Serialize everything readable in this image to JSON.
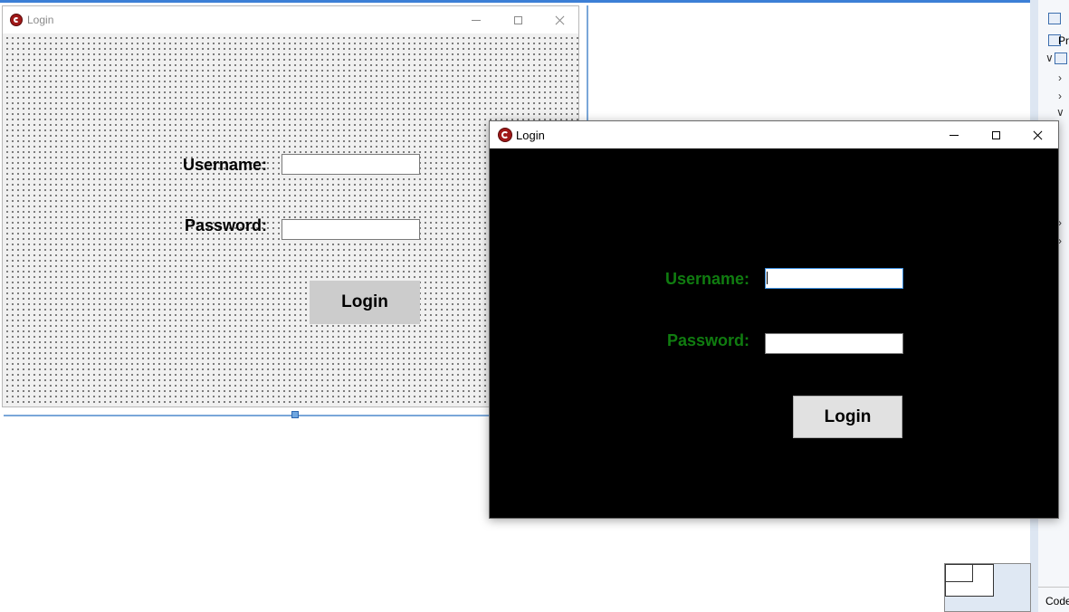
{
  "designer": {
    "title": "Login",
    "username_label": "Username:",
    "password_label": "Password:",
    "login_button": "Login"
  },
  "running_app": {
    "title": "Login",
    "username_label": "Username:",
    "password_label": "Password:",
    "username_value": "",
    "password_value": "",
    "login_button": "Login",
    "label_color": "#107c10",
    "background_color": "#000000"
  },
  "ide_panel": {
    "item_label": "Pr",
    "code_tab": "Code"
  },
  "icons": {
    "app": "app-logo-icon",
    "minimize": "minimize-icon",
    "maximize": "maximize-icon",
    "close": "close-icon"
  }
}
